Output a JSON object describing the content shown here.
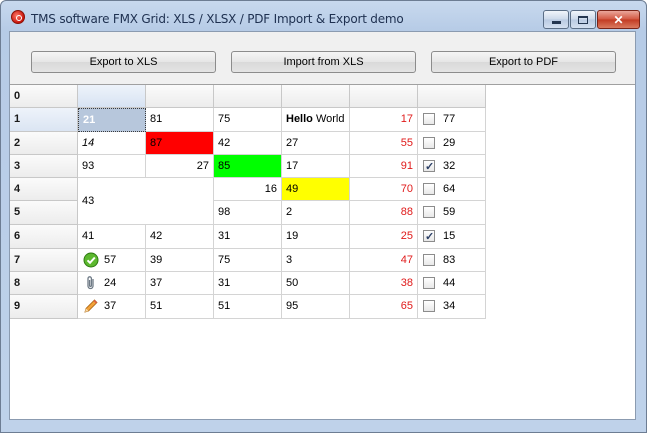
{
  "window": {
    "title": "TMS software FMX Grid: XLS / XLSX / PDF Import & Export demo",
    "close_glyph": "✕",
    "accent_color": "#c8d9ee"
  },
  "toolbar": {
    "export_xls_label": "Export to XLS",
    "import_xls_label": "Import from XLS",
    "export_pdf_label": "Export to PDF"
  },
  "grid": {
    "row_headers": [
      "0",
      "1",
      "2",
      "3",
      "4",
      "5",
      "6",
      "7",
      "8",
      "9"
    ],
    "rows": {
      "r1": {
        "c1": "21",
        "c2": "81",
        "c3": "75",
        "c4_bold": "Hello",
        "c4_rest": "World",
        "c5": "17",
        "c6": "77"
      },
      "r2": {
        "c1": "14",
        "c2": "87",
        "c3": "42",
        "c4": "27",
        "c5": "55",
        "c6": "29"
      },
      "r3": {
        "c1": "93",
        "c2": "27",
        "c3": "85",
        "c4": "17",
        "c5": "91",
        "c6": "32"
      },
      "r4": {
        "c1": "43",
        "c3": "16",
        "c4": "49",
        "c5": "70",
        "c6": "64"
      },
      "r5": {
        "c3": "98",
        "c4": "2",
        "c5": "88",
        "c6": "59"
      },
      "r6": {
        "c1": "41",
        "c2": "42",
        "c3": "31",
        "c4": "19",
        "c5": "25",
        "c6": "15"
      },
      "r7": {
        "c1": "57",
        "c2": "39",
        "c3": "75",
        "c4": "3",
        "c5": "47",
        "c6": "83"
      },
      "r8": {
        "c1": "24",
        "c2": "37",
        "c3": "31",
        "c4": "50",
        "c5": "38",
        "c6": "44"
      },
      "r9": {
        "c1": "37",
        "c2": "51",
        "c3": "51",
        "c4": "95",
        "c5": "65",
        "c6": "34"
      }
    },
    "checked": {
      "r1": false,
      "r2": false,
      "r3": true,
      "r4": false,
      "r5": false,
      "r6": true,
      "r7": false,
      "r8": false,
      "r9": false
    },
    "colors": {
      "red_text": "#e01a1a",
      "red_fill": "#ff0000",
      "green_fill": "#00ff00",
      "yellow_fill": "#ffff00",
      "selection": "#b7c7dc"
    },
    "icons": {
      "r7": "check-circle-icon",
      "r8": "paperclip-icon",
      "r9": "pencil-icon"
    }
  }
}
